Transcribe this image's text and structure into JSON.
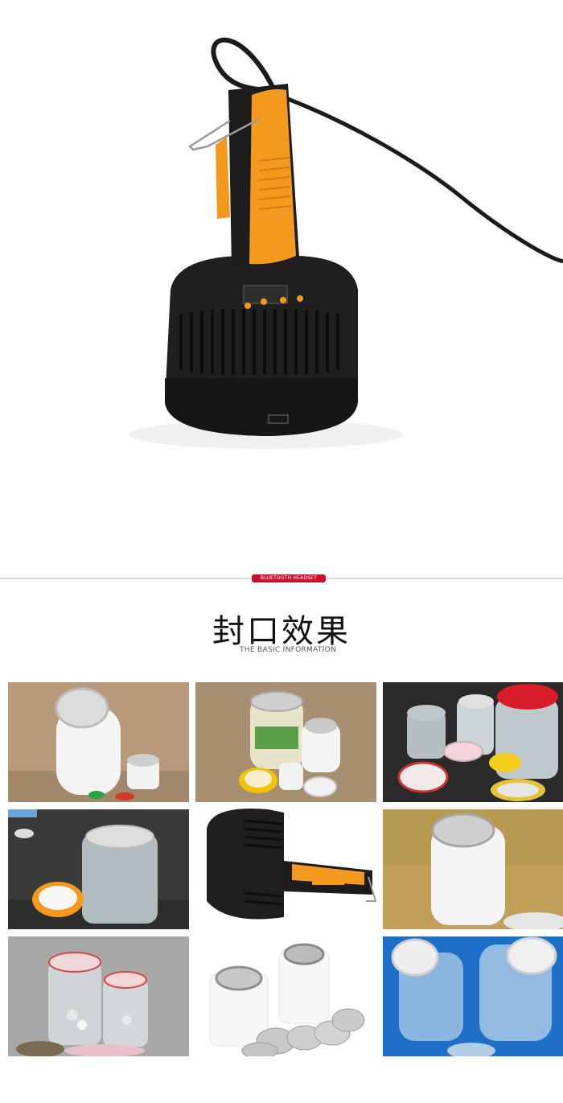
{
  "section": {
    "tag": "BLUETOOTH HEADSET",
    "title": "封口效果",
    "subtitle": "THE BASIC INFORMATION"
  },
  "colors": {
    "accent": "#c8102e",
    "handle_orange": "#f39a1e",
    "device_black": "#1f1f1f"
  },
  "gallery": {
    "tiles": [
      {
        "name": "sealed-white-bottle-photo"
      },
      {
        "name": "sealed-glass-jar-photo"
      },
      {
        "name": "assorted-sealed-jars-photo"
      },
      {
        "name": "clear-jar-with-orange-lid-photo"
      },
      {
        "name": "sealer-head-closeup-photo"
      },
      {
        "name": "sealed-bottle-neck-photo"
      },
      {
        "name": "jars-with-seal-liners-photo"
      },
      {
        "name": "white-jars-foil-liners-photo"
      },
      {
        "name": "clear-bottles-blue-background-photo"
      }
    ]
  }
}
